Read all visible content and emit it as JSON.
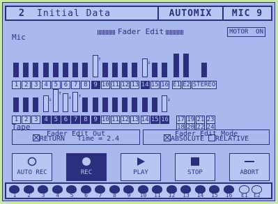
{
  "header": {
    "scene_number": "2",
    "scene_name": "Initial Data",
    "mode": "AUTOMIX",
    "input": "MIC 9"
  },
  "fader_edit": {
    "title": "Fader Edit",
    "motor_label": "MOTOR",
    "motor_state": "ON"
  },
  "mic": {
    "label": "Mic",
    "channels": [
      "1",
      "2",
      "3",
      "4",
      "5",
      "6",
      "7",
      "8",
      "9",
      "10",
      "11",
      "12",
      "13",
      "14",
      "15",
      "16",
      "E1",
      "E2",
      "STEREO"
    ],
    "selected": [
      "9",
      "14"
    ],
    "levels": [
      0.62,
      0.62,
      0.62,
      0.62,
      0.62,
      0.62,
      0.62,
      0.62,
      0.94,
      0.62,
      0.62,
      0.62,
      0.62,
      0.78,
      0.62,
      0.62,
      1.0,
      1.0,
      0.62
    ]
  },
  "tape": {
    "label": "Tape",
    "channels": [
      "1",
      "2",
      "3",
      "4",
      "5",
      "6",
      "7",
      "8",
      "9",
      "10",
      "11",
      "12",
      "13",
      "14",
      "15",
      "16"
    ],
    "extra_channels": [
      "17",
      "18",
      "19",
      "20",
      "21",
      "22",
      "23",
      "24"
    ],
    "selected": [
      "4",
      "5",
      "6",
      "7",
      "8",
      "9",
      "15",
      "16"
    ],
    "levels": [
      0.62,
      0.62,
      0.62,
      0.72,
      0.98,
      0.78,
      0.86,
      0.62,
      0.62,
      0.62,
      0.62,
      0.62,
      0.62,
      0.62,
      0.62,
      0.72
    ]
  },
  "fader_edit_out": {
    "title": "Fader Edit Out",
    "return_label": "RETURN",
    "return_checked": true,
    "time_label": "Time =",
    "time_value": "2.4"
  },
  "fader_edit_mode": {
    "title": "Fader Edit Mode",
    "absolute_label": "ABSOLUTE",
    "absolute_checked": true,
    "relative_label": "RELATIVE",
    "relative_checked": false
  },
  "buttons": {
    "auto_rec": "AUTO REC",
    "rec": "REC",
    "play": "PLAY",
    "stop": "STOP",
    "abort": "ABORT"
  },
  "strip": {
    "labels": [
      "1",
      "2",
      "3",
      "4",
      "5",
      "6",
      "7",
      "8",
      "9",
      "10",
      "11",
      "12",
      "13",
      "14",
      "15",
      "16",
      "E1",
      "E2"
    ]
  },
  "colors": {
    "background": "#a9b9ee",
    "ink": "#2b2f7e",
    "outer": "#c8e6a8"
  }
}
